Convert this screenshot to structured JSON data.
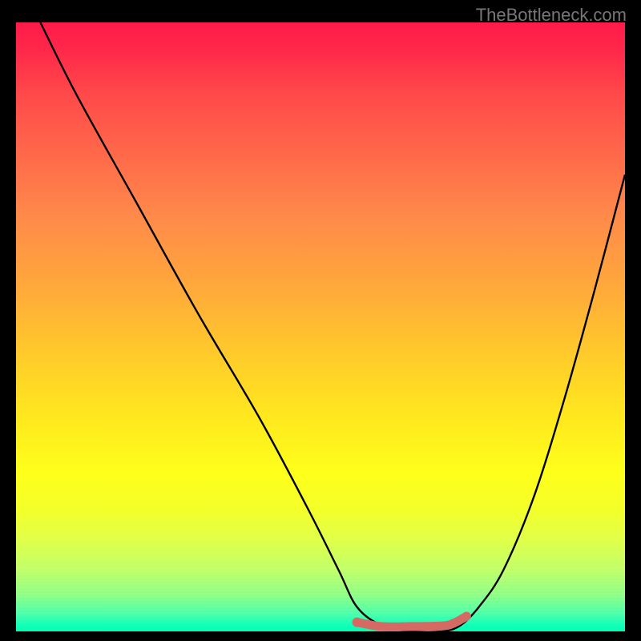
{
  "watermark": "TheBottleneck.com",
  "chart_data": {
    "type": "line",
    "title": "",
    "xlabel": "",
    "ylabel": "",
    "xlim": [
      0,
      100
    ],
    "ylim": [
      0,
      100
    ],
    "grid": false,
    "series": [
      {
        "name": "black-curve",
        "color": "#000000",
        "x": [
          4,
          10,
          20,
          30,
          40,
          48,
          53,
          56,
          60,
          65,
          70,
          73,
          76,
          80,
          85,
          90,
          95,
          100
        ],
        "values": [
          100,
          88,
          70,
          52,
          35,
          20,
          10,
          4,
          1,
          0,
          0,
          1,
          4,
          10,
          22,
          38,
          56,
          75
        ]
      },
      {
        "name": "red-curve-segment",
        "color": "#d46a63",
        "x": [
          56,
          60,
          65,
          70,
          72,
          74
        ],
        "values": [
          1.5,
          0.8,
          0.8,
          0.9,
          1.4,
          2.5
        ]
      }
    ],
    "annotations": []
  }
}
